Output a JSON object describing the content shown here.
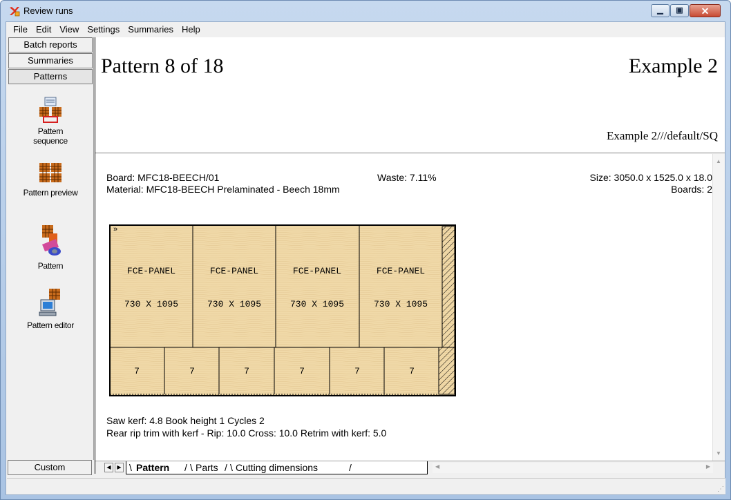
{
  "window": {
    "title": "Review runs",
    "buttons": [
      "minimize",
      "maximize",
      "close"
    ]
  },
  "menu": [
    "File",
    "Edit",
    "View",
    "Settings",
    "Summaries",
    "Help"
  ],
  "left_panel": {
    "top_buttons": [
      "Batch reports",
      "Summaries",
      "Patterns"
    ],
    "tools": [
      {
        "label_line1": "Pattern",
        "label_line2": "sequence",
        "icon": "pattern-sequence-icon"
      },
      {
        "label_line1": "Pattern preview",
        "label_line2": "",
        "icon": "pattern-preview-icon"
      },
      {
        "label_line1": "Pattern",
        "label_line2": "",
        "icon": "pattern-icon"
      },
      {
        "label_line1": "Pattern editor",
        "label_line2": "",
        "icon": "pattern-editor-icon"
      }
    ],
    "bottom_button": "Custom"
  },
  "header": {
    "pattern_title": "Pattern 8 of 18",
    "example_title": "Example 2",
    "example_path": "Example 2///default/SQ"
  },
  "info": {
    "board": "Board: MFC18-BEECH/01",
    "waste": "Waste: 7.11%",
    "size": "Size: 3050.0 x 1525.0 x  18.0",
    "material": "Material: MFC18-BEECH  Prelaminated - Beech 18mm",
    "boards": "Boards: 2",
    "saw_kerf": "Saw kerf: 4.8  Book height 1  Cycles 2",
    "trim": "Rear rip trim with kerf - Rip: 10.0 Cross: 10.0 Retrim with kerf: 5.0"
  },
  "pattern": {
    "top_row_part": "FCE-PANEL",
    "top_row_dims": "730 X 1095",
    "top_row_count": 4,
    "bottom_row_labels": [
      "7",
      "7",
      "7",
      "7",
      "7",
      "7"
    ],
    "colors": {
      "board": "#f0d9a8",
      "line": "#000000"
    }
  },
  "tabs": {
    "items": [
      "Pattern",
      "Parts",
      "Cutting dimensions"
    ],
    "active": "Pattern"
  }
}
